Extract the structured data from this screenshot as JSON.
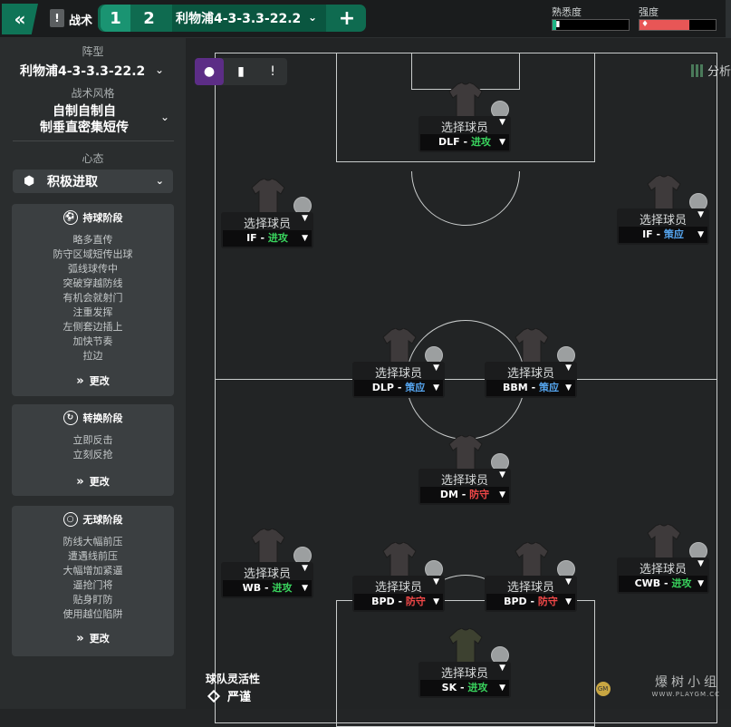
{
  "topbar": {
    "back_icon": "double-chevron-left-icon",
    "tactics_label": "战术",
    "slots": [
      "1",
      "2"
    ],
    "formation_select": "利物浦4-3-3.3-22.2",
    "add_icon": "plus-icon",
    "familiarity_label": "熟悉度",
    "familiarity_level": 0.05,
    "intensity_label": "强度",
    "intensity_level": 0.66,
    "colors": {
      "accent": "#0f7457",
      "familiarity": "#1db584",
      "intensity": "#e85656"
    }
  },
  "sidebar": {
    "formation_title": "阵型",
    "formation_value": "利物浦4-3-3.3-22.2",
    "style_title": "战术风格",
    "style_value_line1": "自制自制自",
    "style_value_line2": "制垂直密集短传",
    "mentality_title": "心态",
    "mentality_value": "积极进取",
    "phases": [
      {
        "title": "持球阶段",
        "icon": "football-icon",
        "items": [
          "略多直传",
          "防守区域短传出球",
          "弧线球传中",
          "突破穿越防线",
          "有机会就射门",
          "注重发挥",
          "左侧套边插上",
          "加快节奏",
          "拉边"
        ],
        "change_label": "更改"
      },
      {
        "title": "转换阶段",
        "icon": "transition-icon",
        "items": [
          "立即反击",
          "立刻反抢"
        ],
        "change_label": "更改"
      },
      {
        "title": "无球阶段",
        "icon": "ball-outline-icon",
        "items": [
          "防线大幅前压",
          "遭遇线前压",
          "大幅增加紧逼",
          "逼抢门将",
          "贴身盯防",
          "使用越位陷阱"
        ],
        "change_label": "更改"
      }
    ]
  },
  "pitch": {
    "tabs": [
      "person-icon",
      "bar-chart-icon",
      "alert-icon"
    ],
    "analysis_label": "分析",
    "flexibility_title": "球队灵活性",
    "flexibility_value": "严谨",
    "players": [
      {
        "name": "选择球员",
        "role": "DLF",
        "duty": "进攻",
        "duty_type": "attack"
      },
      {
        "name": "选择球员",
        "role": "IF",
        "duty": "进攻",
        "duty_type": "attack"
      },
      {
        "name": "选择球员",
        "role": "IF",
        "duty": "策应",
        "duty_type": "support"
      },
      {
        "name": "选择球员",
        "role": "DLP",
        "duty": "策应",
        "duty_type": "support"
      },
      {
        "name": "选择球员",
        "role": "BBM",
        "duty": "策应",
        "duty_type": "support"
      },
      {
        "name": "选择球员",
        "role": "DM",
        "duty": "防守",
        "duty_type": "defend"
      },
      {
        "name": "选择球员",
        "role": "WB",
        "duty": "进攻",
        "duty_type": "attack"
      },
      {
        "name": "选择球员",
        "role": "BPD",
        "duty": "防守",
        "duty_type": "defend"
      },
      {
        "name": "选择球员",
        "role": "BPD",
        "duty": "防守",
        "duty_type": "defend"
      },
      {
        "name": "选择球员",
        "role": "CWB",
        "duty": "进攻",
        "duty_type": "attack"
      },
      {
        "name": "选择球员",
        "role": "SK",
        "duty": "进攻",
        "duty_type": "attack"
      }
    ]
  },
  "watermark": {
    "text": "爆树小组",
    "url": "WWW.PLAYGM.CC"
  }
}
